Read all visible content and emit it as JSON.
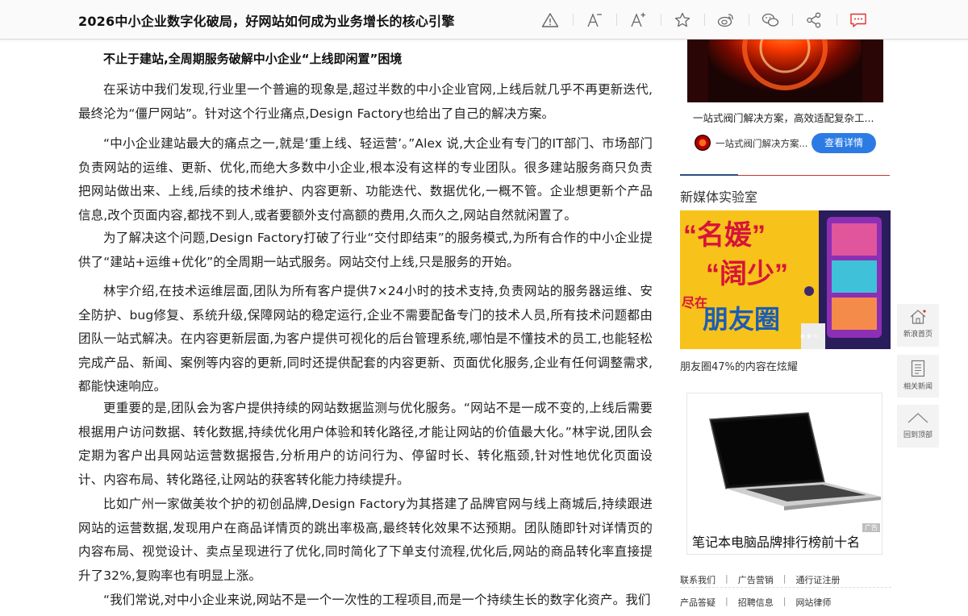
{
  "header": {
    "title": "2026中小企业数字化破局，好网站如何成为业务增长的核心引擎",
    "tools": [
      {
        "name": "warning-icon"
      },
      {
        "name": "font-decrease-icon"
      },
      {
        "name": "font-increase-icon"
      },
      {
        "name": "star-icon"
      },
      {
        "name": "weibo-icon"
      },
      {
        "name": "wechat-icon"
      },
      {
        "name": "share-icon"
      },
      {
        "name": "comment-icon",
        "color": "#e0312f"
      }
    ]
  },
  "article": {
    "subhead": "不止于建站,全周期服务破解中小企业“上线即闲置”困境",
    "paragraphs": [
      "在采访中我们发现,行业里一个普遍的现象是,超过半数的中小企业官网,上线后就几乎不再更新迭代,最终沦为“僵尸网站”。针对这个行业痛点,Design Factory也给出了自己的解决方案。",
      "“中小企业建站最大的痛点之一,就是‘重上线、轻运营’。”Alex 说,大企业有专门的IT部门、市场部门负责网站的运维、更新、优化,而绝大多数中小企业,根本没有这样的专业团队。很多建站服务商只负责把网站做出来、上线,后续的技术维护、内容更新、功能迭代、数据优化,一概不管。企业想更新个产品信息,改个页面内容,都找不到人,或者要额外支付高额的费用,久而久之,网站自然就闲置了。",
      "为了解决这个问题,Design Factory打破了行业“交付即结束”的服务模式,为所有合作的中小企业提供了“建站+运维+优化”的全周期一站式服务。网站交付上线,只是服务的开始。",
      "林宇介绍,在技术运维层面,团队为所有客户提供7×24小时的技术支持,负责网站的服务器运维、安全防护、bug修复、系统升级,保障网站的稳定运行,企业不需要配备专门的技术人员,所有技术问题都由团队一站式解决。在内容更新层面,为客户提供可视化的后台管理系统,哪怕是不懂技术的员工,也能轻松完成产品、新闻、案例等内容的更新,同时还提供配套的内容更新、页面优化服务,企业有任何调整需求,都能快速响应。",
      "更重要的是,团队会为客户提供持续的网站数据监测与优化服务。“网站不是一成不变的,上线后需要根据用户访问数据、转化数据,持续优化用户体验和转化路径,才能让网站的价值最大化。”林宇说,团队会定期为客户出具网站运营数据报告,分析用户的访问行为、停留时长、转化瓶颈,针对性地优化页面设计、内容布局、转化路径,让网站的获客转化能力持续提升。",
      "比如广州一家做美妆个护的初创品牌,Design Factory为其搭建了品牌官网与线上商城后,持续跟进网站的运营数据,发现用户在商品详情页的跳出率极高,最终转化效果不达预期。团队随即针对详情页的内容布局、视觉设计、卖点呈现进行了优化,同时简化了下单支付流程,优化后,网站的商品转化率直接提升了32%,复购率也有明显上涨。",
      "“我们常说,对中小企业来说,网站不是一个一次性的工程项目,而是一个持续生长的数字化资产。我们"
    ]
  },
  "sidebar": {
    "ad_top": {
      "caption": "一站式阀门解决方案，高效适配复杂工...",
      "brand": "一站式阀门解决方案...",
      "button": "查看详情"
    },
    "section_title": "新媒体实验室",
    "promo": {
      "lines": [
        "“名媛”",
        "“阔少”",
        "尽在",
        "朋友圈"
      ],
      "caption": "朋友圈47%的内容在炫耀"
    },
    "laptop_ad": {
      "badge": "广告",
      "caption": "笔记本电脑品牌排行榜前十名"
    },
    "footer_links": [
      [
        "联系我们",
        "广告营销",
        "通行证注册"
      ],
      [
        "产品答疑",
        "招聘信息",
        "网站律师"
      ]
    ],
    "footer_sep": "|"
  },
  "sidenav": [
    {
      "icon": "home-icon",
      "label": "新浪首页"
    },
    {
      "icon": "news-list-icon",
      "label": "相关新闻"
    },
    {
      "icon": "back-to-top-icon",
      "label": "回到顶部"
    }
  ]
}
